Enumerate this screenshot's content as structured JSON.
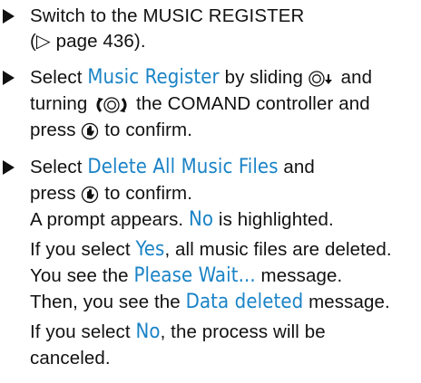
{
  "steps": [
    {
      "line1": "Switch to the MUSIC REGISTER",
      "line2": "(▷ page 436)."
    },
    {
      "line1_pre": "Select ",
      "line1_hl": "Music Register",
      "line1_post": " by sliding ",
      "line1_end": " and",
      "line2_pre": "turning ",
      "line2_post": " the COMAND controller and",
      "line3_pre": "press ",
      "line3_post": " to confirm."
    },
    {
      "line1_pre": "Select ",
      "line1_hl": "Delete All Music Files",
      "line1_post": " and",
      "line2_pre": "press ",
      "line2_post": " to confirm.",
      "prompt_pre": "A prompt appears. ",
      "prompt_hl": "No",
      "prompt_post": " is highlighted.",
      "yes_pre": "If you select ",
      "yes_hl": "Yes",
      "yes_post": ", all music files are deleted.",
      "wait_pre": "You see the ",
      "wait_hl": "Please Wait...",
      "wait_post": " message.",
      "deleted_pre": "Then, you see the ",
      "deleted_hl": "Data deleted",
      "deleted_post": " message.",
      "no_pre": "If you select ",
      "no_hl": "No",
      "no_post": ", the process will be",
      "no_line2": "canceled."
    }
  ],
  "icons": [
    "controller-slide-down-icon",
    "controller-turn-icon",
    "controller-press-icon"
  ]
}
